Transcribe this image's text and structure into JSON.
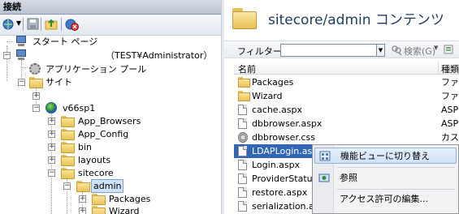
{
  "left_pane": {
    "header": "接続",
    "tree": {
      "start_page": "スタート ページ",
      "server": "（TEST¥Administrator）",
      "app_pools": "アプリケーション プール",
      "sites": "サイト",
      "site_name": "v66sp1",
      "folders": [
        "App_Browsers",
        "App_Config",
        "bin",
        "layouts",
        "sitecore"
      ],
      "admin": "admin",
      "admin_children": [
        "Packages",
        "Wizard"
      ]
    }
  },
  "right_pane": {
    "title": "sitecore/admin コンテンツ",
    "filter_label": "フィルター:",
    "filter_value": "",
    "search_label": "検索(G)",
    "columns": {
      "name": "名前",
      "type": "種類"
    },
    "files": [
      {
        "name": "Packages",
        "type": "ファイ",
        "icon": "folder-icon"
      },
      {
        "name": "Wizard",
        "type": "ファイ",
        "icon": "folder-icon"
      },
      {
        "name": "cache.aspx",
        "type": "ASP",
        "icon": "file-icon"
      },
      {
        "name": "dbbrowser.aspx",
        "type": "ASP",
        "icon": "file-icon"
      },
      {
        "name": "dbbrowser.css",
        "type": "カスク",
        "icon": "css-file-icon"
      },
      {
        "name": "LDAPLogin.aspx",
        "type": "",
        "icon": "file-icon",
        "selected": true
      },
      {
        "name": "Login.aspx",
        "type": "",
        "icon": "file-icon"
      },
      {
        "name": "ProviderStatus",
        "type": "",
        "icon": "file-icon"
      },
      {
        "name": "restore.aspx",
        "type": "",
        "icon": "file-icon"
      },
      {
        "name": "serialization.as",
        "type": "",
        "icon": "file-icon"
      }
    ]
  },
  "context_menu": {
    "items": [
      "機能ビューに切り替え",
      "参照",
      "アクセス許可の編集..."
    ]
  },
  "colors": {
    "selection": "#3166b5",
    "menu_highlight": "#cfe2f9",
    "folder": "#e9c15a"
  }
}
